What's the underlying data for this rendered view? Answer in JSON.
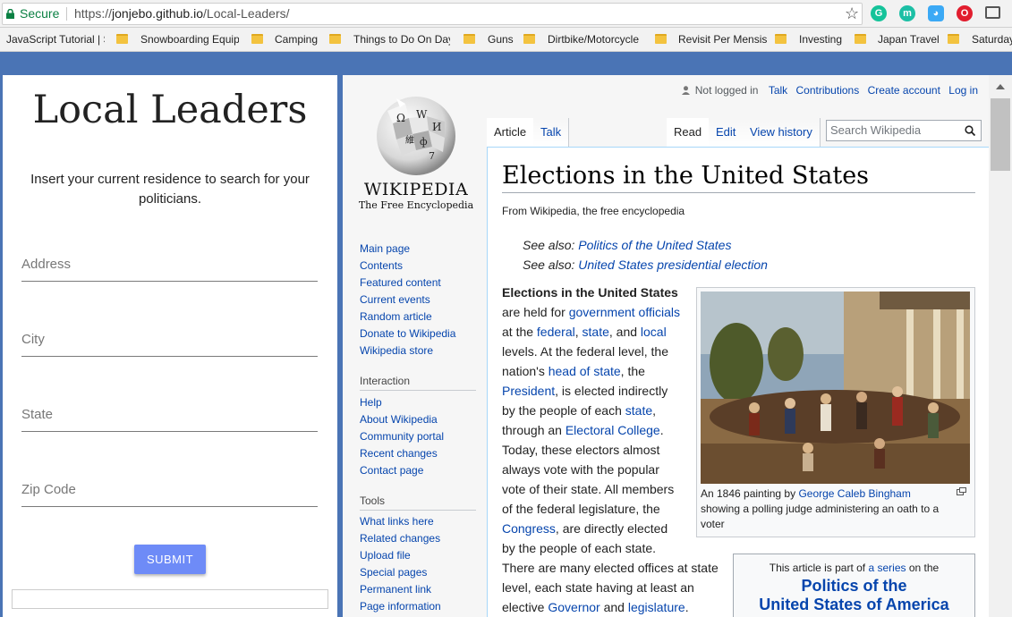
{
  "browser": {
    "secure_label": "Secure",
    "url_scheme": "https://",
    "url_host": "jonjebo.github.io",
    "url_path": "/Local-Leaders/",
    "bookmarks": [
      "JavaScript Tutorial | S",
      "Snowboarding Equip",
      "Camping",
      "Things to Do On Day",
      "Guns",
      "Dirtbike/Motorcycle",
      "Revisit Per Mensis",
      "Investing",
      "Japan Travel",
      "Saturday"
    ]
  },
  "app": {
    "title": "Local Leaders",
    "instructions": "Insert your current residence to search for your politicians.",
    "fields": {
      "address": "Address",
      "city": "City",
      "state": "State",
      "zip": "Zip Code"
    },
    "submit_label": "SUBMIT"
  },
  "wiki": {
    "wordmark": "WIKIPEDIA",
    "tagline": "The Free Encyclopedia",
    "personal": {
      "not_logged_in": "Not logged in",
      "talk": "Talk",
      "contributions": "Contributions",
      "create_account": "Create account",
      "log_in": "Log in"
    },
    "tabs": {
      "article": "Article",
      "talk": "Talk",
      "read": "Read",
      "edit": "Edit",
      "history": "View history"
    },
    "search_placeholder": "Search Wikipedia",
    "nav": [
      "Main page",
      "Contents",
      "Featured content",
      "Current events",
      "Random article",
      "Donate to Wikipedia",
      "Wikipedia store"
    ],
    "interaction_heading": "Interaction",
    "interaction": [
      "Help",
      "About Wikipedia",
      "Community portal",
      "Recent changes",
      "Contact page"
    ],
    "tools_heading": "Tools",
    "tools": [
      "What links here",
      "Related changes",
      "Upload file",
      "Special pages",
      "Permanent link",
      "Page information"
    ],
    "article": {
      "title": "Elections in the United States",
      "site_sub": "From Wikipedia, the free encyclopedia",
      "see_also_label": "See also:",
      "see_also_1": "Politics of the United States",
      "see_also_2": "United States presidential election",
      "caption_pre": "An 1846 painting by",
      "caption_link": "George Caleb Bingham",
      "caption_post": "showing a polling judge administering an oath to a voter",
      "infobox_intro_pre": "This article is part of",
      "infobox_intro_link": "a series",
      "infobox_intro_post": "on the",
      "infobox_title_1": "Politics of the",
      "infobox_title_2": "United States of America"
    }
  },
  "colors": {
    "secure": "#0b8043",
    "submit": "#6e8bf7",
    "link": "#0645ad",
    "desktop": "#4a74b5"
  }
}
